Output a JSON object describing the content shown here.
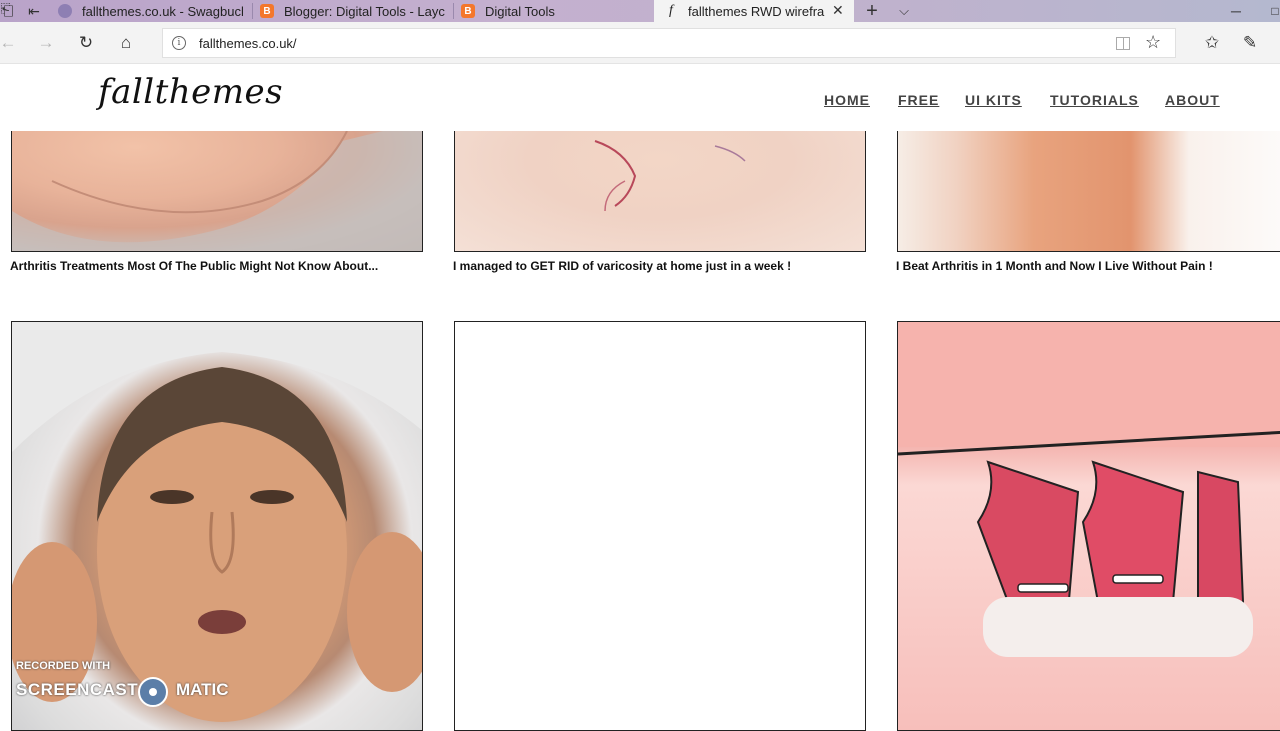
{
  "browser": {
    "tabs": [
      {
        "title": "fallthemes.co.uk - Swagbucl",
        "favicon": "swagbucks-icon"
      },
      {
        "title": "Blogger: Digital Tools - Layc",
        "favicon": "blogger-icon"
      },
      {
        "title": "Digital Tools",
        "favicon": "blogger-icon"
      },
      {
        "title": "fallthemes RWD wirefra",
        "favicon": "f-icon",
        "active": true
      }
    ],
    "active_tab_favicon_glyph": "f",
    "blogger_glyph": "B",
    "url": "fallthemes.co.uk/",
    "url_info_glyph": "i"
  },
  "site": {
    "logo": "fallthemes",
    "menu": [
      "HOME",
      "FREE",
      "UI KITS",
      "TUTORIALS",
      "ABOUT"
    ]
  },
  "grid": {
    "row1_captions": [
      "Arthritis Treatments Most Of The Public Might Not Know About...",
      "I managed to GET RID of varicosity at home just in a week !",
      "I Beat Arthritis in 1 Month and Now I Live Without Pain !"
    ]
  },
  "watermark": {
    "line1": "RECORDED WITH",
    "line2_left": "SCREENCAST",
    "line2_right": "MATIC"
  }
}
